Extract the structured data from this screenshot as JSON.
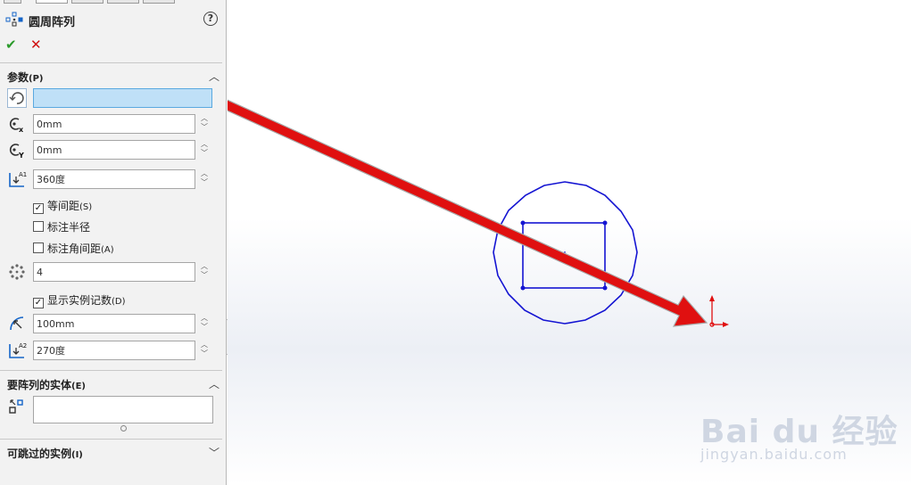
{
  "panel": {
    "title": "圆周阵列",
    "help": "?",
    "ok_symbol": "✔",
    "cancel_symbol": "✕"
  },
  "params": {
    "header": "参数",
    "header_key": "(P)",
    "direction_value": "",
    "center_x": "0mm",
    "center_y": "0mm",
    "angle": "360度",
    "equal_spacing_label": "等间距",
    "equal_spacing_key": "(S)",
    "equal_spacing_checked": true,
    "dim_radius_label": "标注半径",
    "dim_radius_checked": false,
    "dim_angle_label": "标注角间距",
    "dim_angle_key": "(A)",
    "dim_angle_checked": false,
    "count": "4",
    "show_count_label": "显示实例记数",
    "show_count_key": "(D)",
    "show_count_checked": true,
    "radius": "100mm",
    "arc_angle": "270度"
  },
  "entities": {
    "header": "要阵列的实体",
    "header_key": "(E)"
  },
  "skip": {
    "header": "可跳过的实例",
    "header_key": "(I)"
  },
  "watermark": {
    "brand": "Bai du 经验",
    "url": "jingyan.baidu.com"
  },
  "colors": {
    "sketch": "#1414d2",
    "arrow": "#e01010",
    "accept": "#2a9a2a",
    "cancel": "#d01010"
  }
}
